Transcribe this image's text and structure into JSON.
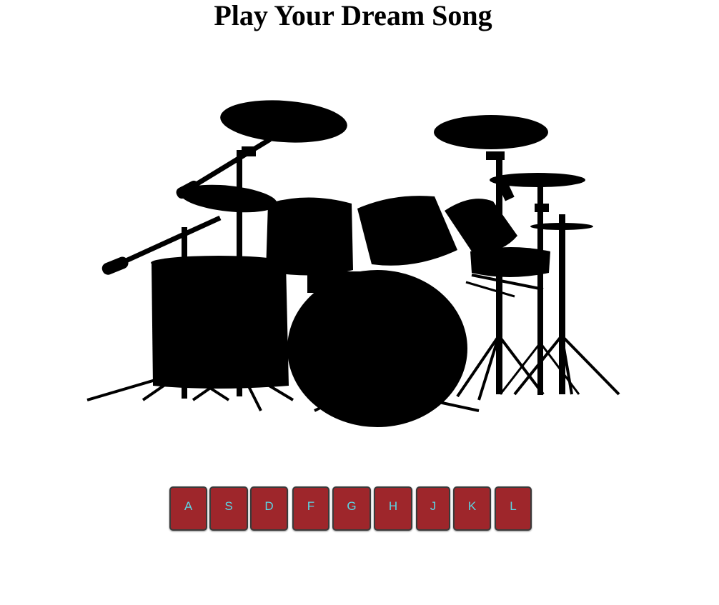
{
  "header": {
    "title": "Play Your Dream Song"
  },
  "drum_kit": {
    "icon": "drum-kit-silhouette",
    "color": "#000000"
  },
  "keys": [
    {
      "label": "A"
    },
    {
      "label": "S"
    },
    {
      "label": "D"
    },
    {
      "label": "F"
    },
    {
      "label": "G"
    },
    {
      "label": "H"
    },
    {
      "label": "J"
    },
    {
      "label": "K"
    },
    {
      "label": "L"
    }
  ],
  "colors": {
    "key_background": "#9e262b",
    "key_text": "#5ad7e6",
    "page_background": "#ffffff"
  }
}
